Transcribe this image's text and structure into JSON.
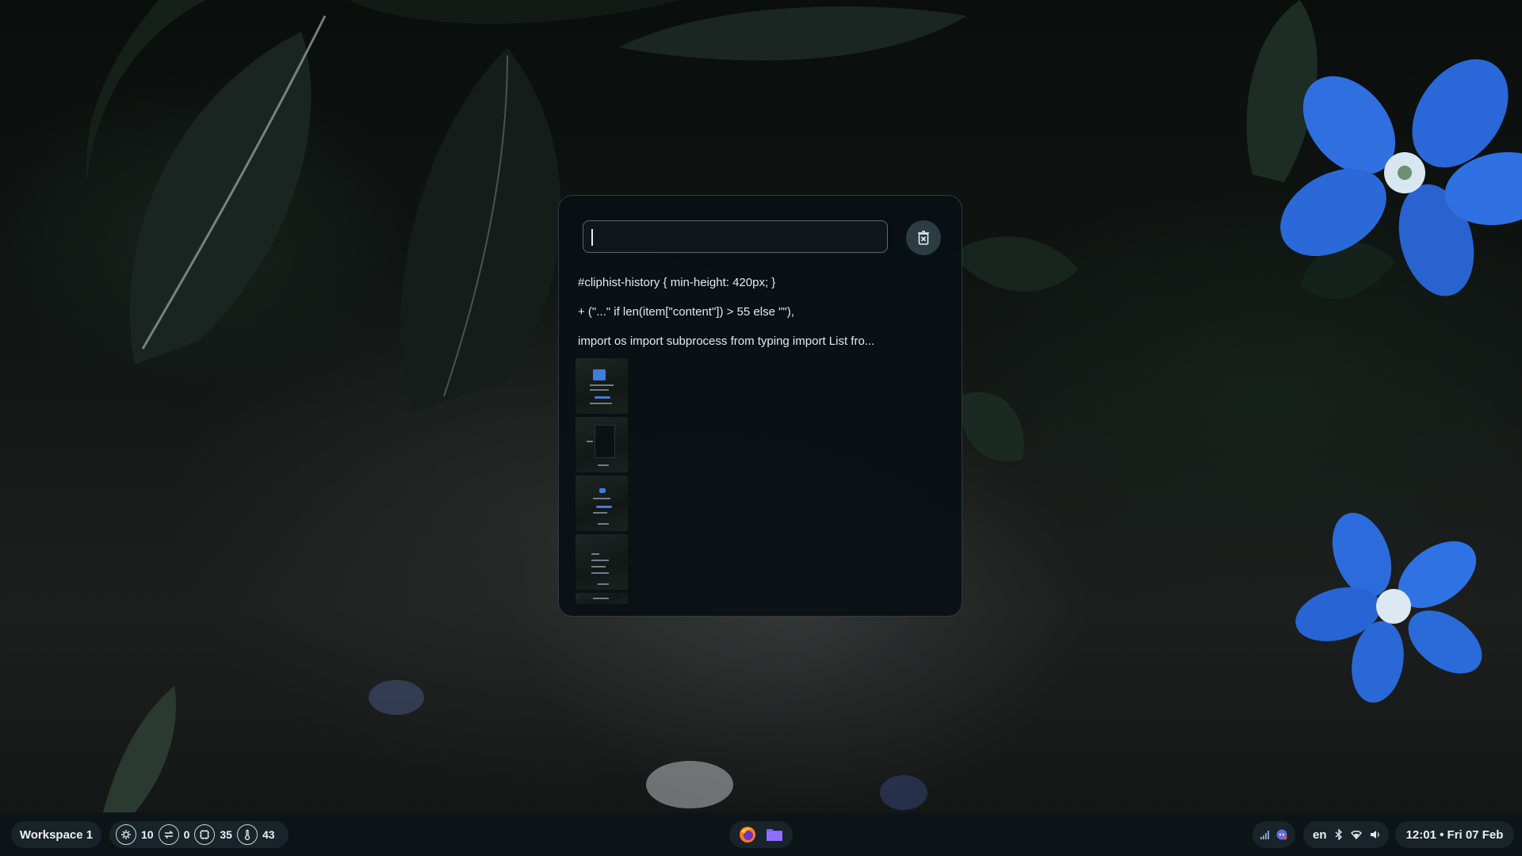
{
  "clipboard": {
    "search": {
      "value": "",
      "placeholder": ""
    },
    "clear_button_icon": "trash-x-icon",
    "history": [
      "#cliphist-history { min-height: 420px; }",
      "+ (\"...\" if len(item[\"content\"]) > 55 else \"\"),",
      "import os import subprocess from typing import List fro..."
    ],
    "image_items_count": 5
  },
  "taskbar": {
    "workspace_label": "Workspace 1",
    "stats": [
      {
        "icon": "cpu-icon",
        "value": "10"
      },
      {
        "icon": "swap-icon",
        "value": "0"
      },
      {
        "icon": "memory-icon",
        "value": "35"
      },
      {
        "icon": "temperature-icon",
        "value": "43"
      }
    ],
    "apps": [
      "firefox-icon",
      "files-icon"
    ],
    "tray": [
      "signal-icon",
      "discord-icon"
    ],
    "keyboard_layout": "en",
    "status_icons": [
      "bluetooth-icon",
      "wifi-icon",
      "volume-icon"
    ],
    "clock": "12:01 • Fri 07 Feb"
  },
  "colors": {
    "panel_bg": "#0a1014",
    "accent_button": "#2b3c42",
    "taskbar_bg": "#0d1417",
    "pill_bg": "#18232a",
    "flower_blue": "#2f74e6"
  }
}
